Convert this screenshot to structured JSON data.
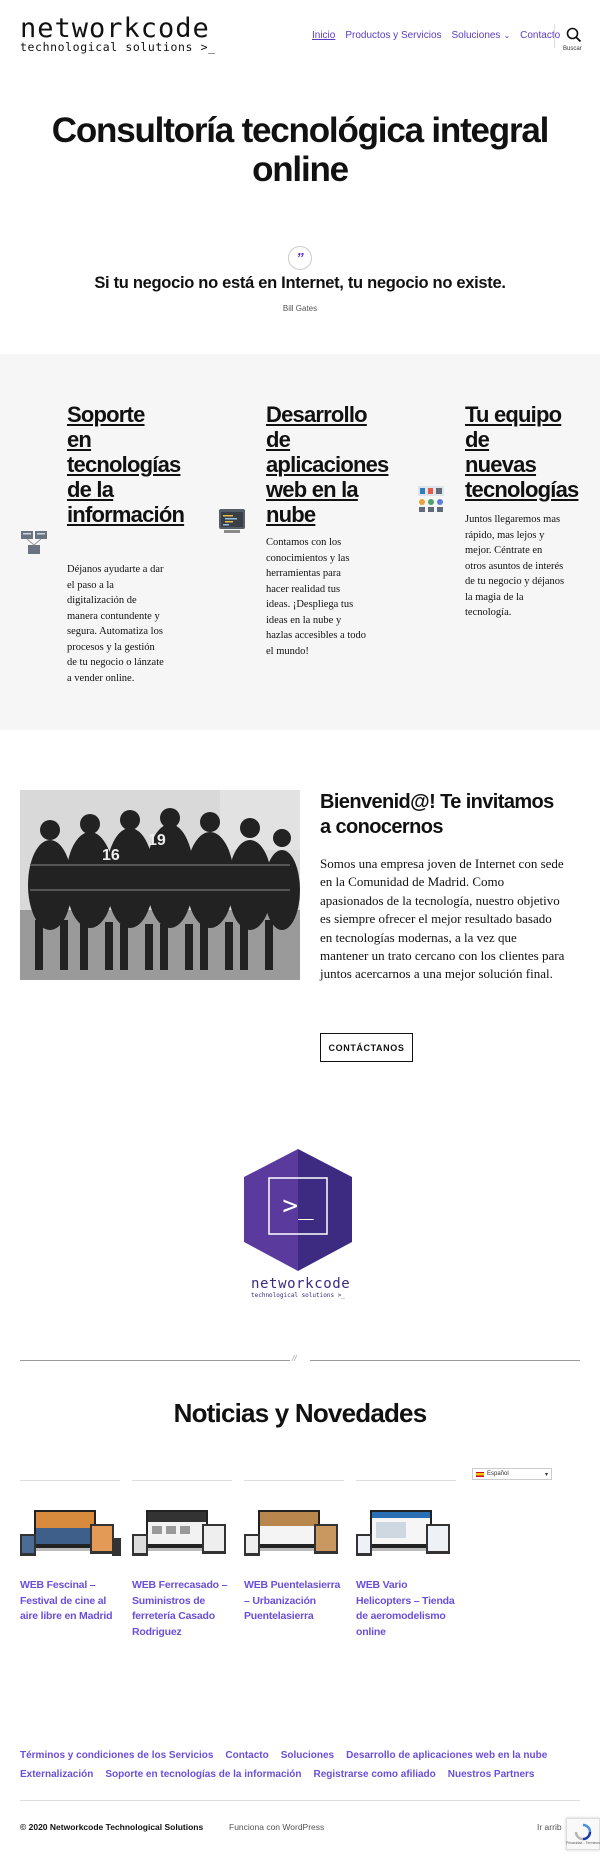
{
  "header": {
    "logo_main": "networkcode",
    "logo_sub": "technological solutions >_",
    "nav": [
      "Inicio",
      "Productos y Servicios",
      "Soluciones",
      "Contacto"
    ],
    "search_label": "Buscar"
  },
  "hero": {
    "title": "Consultoría tecnológica integral online"
  },
  "quote": {
    "mark": "”",
    "text": "Si tu negocio no está en Internet, tu negocio no existe.",
    "author": "Bill Gates"
  },
  "services": [
    {
      "title": "Soporte en tecnologías de la información",
      "text": "Déjanos ayudarte a dar el paso a la digitalización de manera contundente y segura. Automatiza los procesos y la gestión de tu negocio o lánzate a vender online.",
      "icon": "servers-icon"
    },
    {
      "title": "Desarrollo de aplicaciones web en la nube",
      "text": "Contamos con los conocimientos y las herramientas para hacer realidad tus ideas. ¡Despliega tus ideas en la nube y hazlas accesibles a todo el mundo!",
      "icon": "code-icon"
    },
    {
      "title": "Tu equipo de nuevas tecnologías",
      "text": "Juntos llegaremos mas rápido, mas lejos y mejor. Céntrate en otros asuntos de interés de tu negocio y déjanos la magia de la tecnología.",
      "icon": "team-icon"
    }
  ],
  "welcome": {
    "title": "Bienvenid@! Te invitamos a conocernos",
    "text": "Somos una empresa joven de Internet con sede en la Comunidad de Madrid. Como apasionados de la tecnología, nuestro objetivo es siempre ofrecer el mejor resultado basado en tecnologías modernas, a la vez que mantener un trato cercano con los clientes para juntos acercarnos a una mejor solución final.",
    "button": "CONTÁCTANOS"
  },
  "badge": {
    "prompt": ">_",
    "logo_main": "networkcode",
    "logo_sub": "technological solutions >_"
  },
  "divider_mark": "//",
  "news": {
    "title": "Noticias y Novedades",
    "items": [
      "WEB Fescinal – Festival de cine al aire libre en Madrid",
      "WEB Ferrecasado – Suministros de ferretería Casado Rodriguez",
      "WEB Puentelasierra – Urbanización Puentelasierra",
      "WEB Vario Helicopters – Tienda de aeromodelismo online"
    ],
    "language": "Español"
  },
  "footer": {
    "links": [
      "Términos y condiciones de los Servicios",
      "Contacto",
      "Soluciones",
      "Desarrollo de aplicaciones web en la nube",
      "Externalización",
      "Soporte en tecnologías de la información",
      "Registrarse como afiliado",
      "Nuestros Partners"
    ],
    "copyright": "© 2020 Networkcode Technological Solutions",
    "powered": "Funciona con WordPress",
    "top": "Ir arrib",
    "recaptcha": "Privacidad - Términos"
  },
  "colors": {
    "accent": "#5b3cc4",
    "link": "#6b4fd8",
    "badge_left": "#5b3a9e",
    "badge_right": "#3d2b82",
    "section_bg": "#f6f6f6"
  }
}
